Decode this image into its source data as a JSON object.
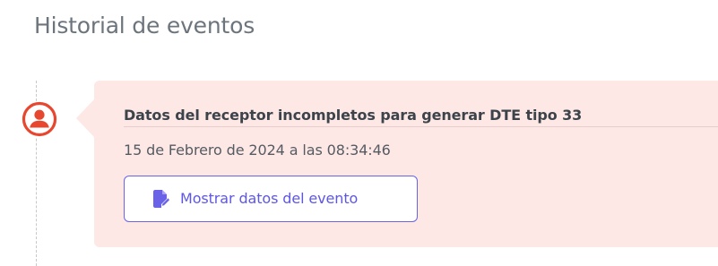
{
  "page": {
    "title": "Historial de eventos"
  },
  "events": [
    {
      "icon": "user-circle-icon",
      "title": "Datos del receptor incompletos para generar DTE tipo 33",
      "date": "15 de Febrero de 2024 a las 08:34:46",
      "button": {
        "label": "Mostrar datos del evento",
        "icon": "file-edit-icon"
      }
    }
  ],
  "colors": {
    "card_background": "#fde8e6",
    "event_icon": "#e8472f",
    "button_accent": "#5e57e3",
    "title_text": "#6c757d"
  }
}
